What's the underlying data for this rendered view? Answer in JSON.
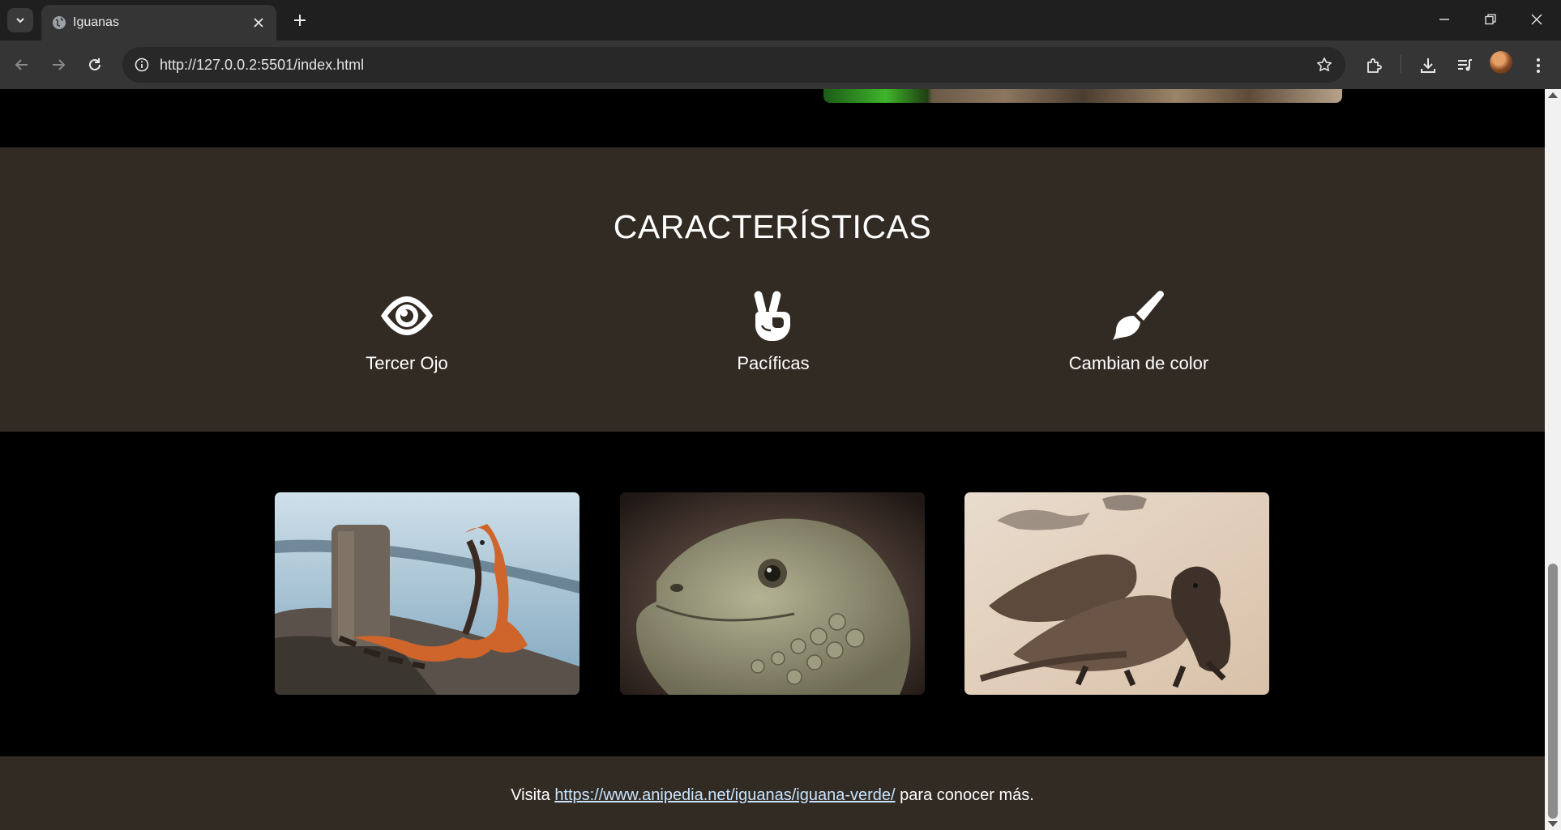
{
  "browser": {
    "tab_title": "Iguanas",
    "url": "http://127.0.0.2:5501/index.html"
  },
  "icons": [
    "tab-search-icon",
    "globe-icon",
    "close-icon",
    "plus-icon",
    "minimize-icon",
    "restore-icon",
    "back-icon",
    "forward-icon",
    "reload-icon",
    "info-icon",
    "star-icon",
    "extensions-icon",
    "download-icon",
    "media-icon",
    "kebab-menu-icon",
    "eye-icon",
    "peace-hand-icon",
    "paintbrush-icon"
  ],
  "features": {
    "title": "CARACTERÍSTICAS",
    "items": [
      {
        "label": "Tercer Ojo",
        "icon": "eye-icon"
      },
      {
        "label": "Pacíficas",
        "icon": "peace-hand-icon"
      },
      {
        "label": "Cambian de color",
        "icon": "paintbrush-icon"
      }
    ]
  },
  "footer": {
    "prefix": "Visita",
    "link": "https://www.anipedia.net/iguanas/iguana-verde/",
    "suffix": "para conocer más."
  },
  "colors": {
    "features_bg": "#322b24",
    "page_bg": "#000000",
    "link": "#c9e4ff"
  }
}
